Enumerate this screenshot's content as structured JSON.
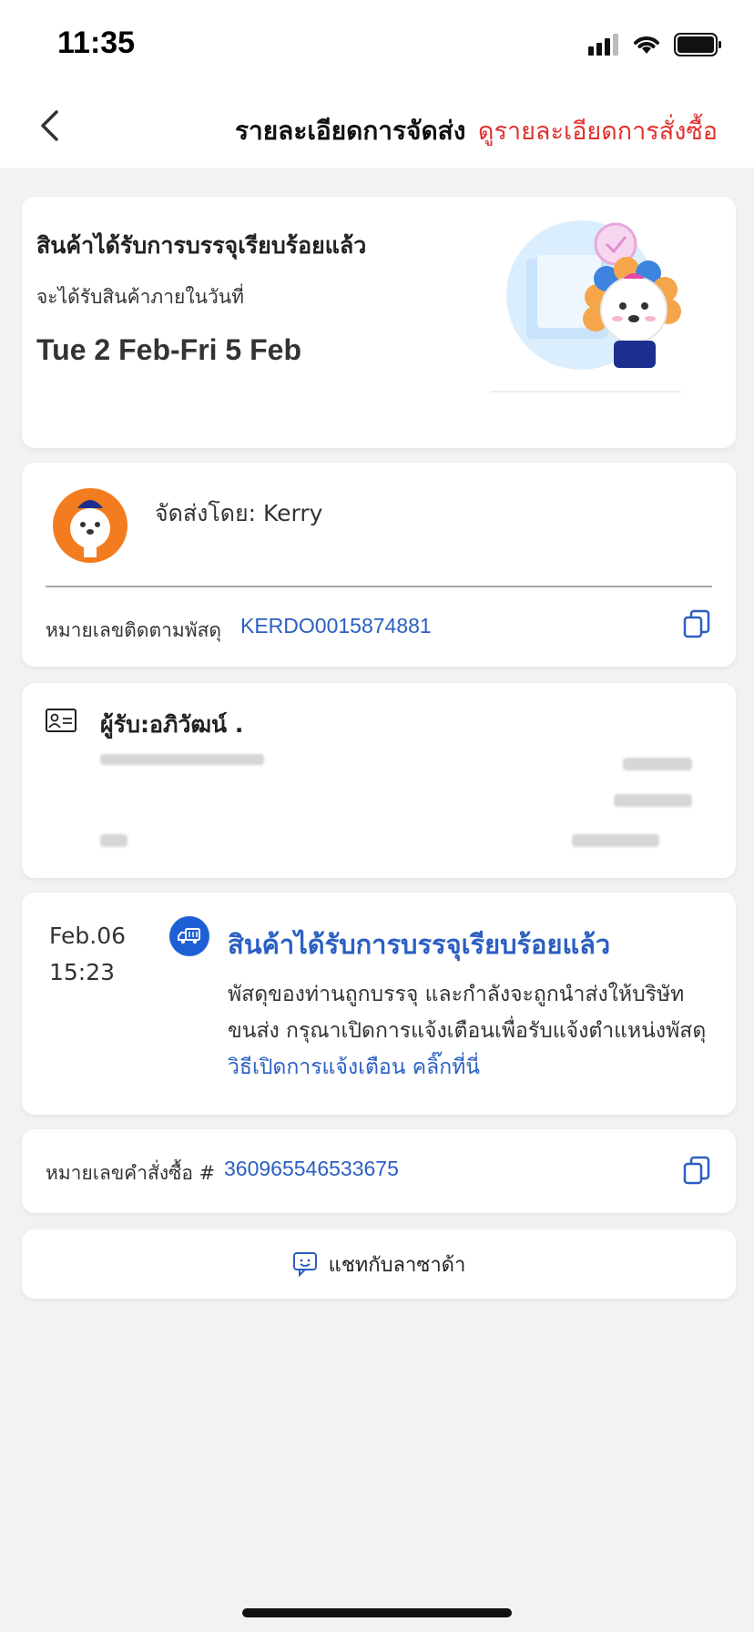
{
  "status_bar": {
    "time": "11:35"
  },
  "nav": {
    "title": "รายละเอียดการจัดส่ง",
    "order_detail_link": "ดูรายละเอียดการสั่งซื้อ"
  },
  "shipment_status": {
    "title": "สินค้าได้รับการบรรจุเรียบร้อยแล้ว",
    "eta_label": "จะได้รับสินค้าภายในวันที่",
    "eta_range": "Tue 2 Feb-Fri 5 Feb"
  },
  "carrier": {
    "text": "จัดส่งโดย: Kerry",
    "tracking_label": "หมายเลขติดตามพัสดุ",
    "tracking_number": "KERDO0015874881"
  },
  "recipient": {
    "name": "ผู้รับ:อภิวัฒน์ ."
  },
  "timeline": [
    {
      "date": "Feb.06",
      "time": "15:23",
      "title": "สินค้าได้รับการบรรจุเรียบร้อยแล้ว",
      "description": "พัสดุของท่านถูกบรรจุ และกำลังจะถูกนำส่งให้บริษัทขนส่ง กรุณาเปิดการแจ้งเตือนเพื่อรับแจ้งตำแหน่งพัสดุ",
      "link": "วิธีเปิดการแจ้งเตือน คลิ๊กที่นี่"
    }
  ],
  "order": {
    "label": "หมายเลขคำสั่งซื้อ #",
    "number": "360965546533675"
  },
  "chat": {
    "label": "แชทกับลาซาด้า"
  },
  "colors": {
    "accent_blue": "#2b5fc2",
    "accent_red": "#e2322f",
    "icon_blue": "#1e5fd6"
  }
}
